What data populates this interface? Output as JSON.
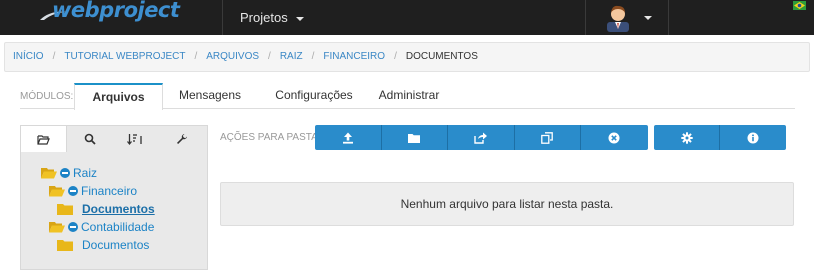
{
  "header": {
    "logo_text": "webproject",
    "nav_projects_label": "Projetos",
    "language_flag": "brazil-flag-icon"
  },
  "breadcrumb": [
    {
      "label": "INÍCIO"
    },
    {
      "label": "TUTORIAL WEBPROJECT"
    },
    {
      "label": "ARQUIVOS"
    },
    {
      "label": "RAIZ"
    },
    {
      "label": "FINANCEIRO"
    },
    {
      "label": "DOCUMENTOS"
    }
  ],
  "modules": {
    "label": "MÓDULOS:",
    "tabs": [
      {
        "label": "Arquivos",
        "active": true
      },
      {
        "label": "Mensagens"
      },
      {
        "label": "Configurações"
      },
      {
        "label": "Administrar"
      }
    ]
  },
  "tree_toolbar": [
    {
      "icon": "folder-open-icon"
    },
    {
      "icon": "search-icon"
    },
    {
      "icon": "sort-icon"
    },
    {
      "icon": "wrench-icon"
    }
  ],
  "tree": [
    {
      "label": "Raiz",
      "level": 0,
      "open": true
    },
    {
      "label": "Financeiro",
      "level": 1,
      "open": true
    },
    {
      "label": "Documentos",
      "level": 2,
      "selected": true
    },
    {
      "label": "Contabilidade",
      "level": 1,
      "open": true
    },
    {
      "label": "Documentos",
      "level": 2
    }
  ],
  "actions": {
    "label": "AÇÕES PARA PASTA:",
    "group1": [
      {
        "icon": "upload-icon"
      },
      {
        "icon": "new-folder-icon"
      },
      {
        "icon": "share-icon"
      },
      {
        "icon": "copy-icon"
      },
      {
        "icon": "delete-icon"
      }
    ],
    "group2": [
      {
        "icon": "gear-icon"
      },
      {
        "icon": "info-icon"
      }
    ]
  },
  "empty_message": "Nenhum arquivo para listar nesta pasta.",
  "colors": {
    "topbar": "#1f1f1f",
    "accent": "#2a8ccb",
    "link": "#1c83c6",
    "folder": "#e8b71a"
  }
}
